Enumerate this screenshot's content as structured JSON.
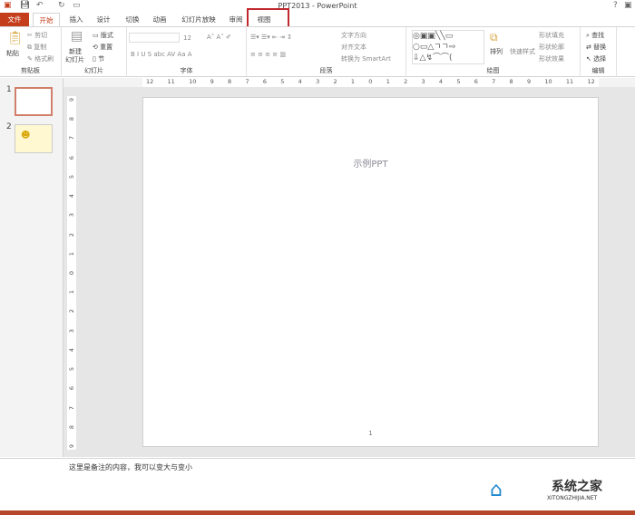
{
  "title": "PPT2013 - PowerPoint",
  "help": "?",
  "tabs": [
    "文件",
    "开始",
    "插入",
    "设计",
    "切换",
    "动画",
    "幻灯片放映",
    "审阅",
    "视图"
  ],
  "ribbon": {
    "clipboard": {
      "label": "剪贴板",
      "paste": "粘贴",
      "cut": "剪切",
      "copy": "复制",
      "format": "格式刷"
    },
    "slides": {
      "label": "幻灯片",
      "new1": "新建",
      "new2": "幻灯片",
      "layout": "版式",
      "reset": "重置",
      "section": "节"
    },
    "font": {
      "label": "字体",
      "size": "12"
    },
    "paragraph": {
      "label": "段落",
      "dir": "文字方向",
      "align": "对齐文本",
      "smart": "转换为 SmartArt"
    },
    "drawing": {
      "label": "绘图",
      "arrange": "排列",
      "quick": "快速样式",
      "fill": "形状填充",
      "outline": "形状轮廓",
      "effect": "形状效果"
    },
    "editing": {
      "label": "编辑",
      "find": "查找",
      "replace": "替换",
      "select": "选择"
    }
  },
  "ruler_h": [
    "12",
    "11",
    "10",
    "9",
    "8",
    "7",
    "6",
    "5",
    "4",
    "3",
    "2",
    "1",
    "0",
    "1",
    "2",
    "3",
    "4",
    "5",
    "6",
    "7",
    "8",
    "9",
    "10",
    "11",
    "12"
  ],
  "ruler_v": [
    "9",
    "8",
    "7",
    "6",
    "5",
    "4",
    "3",
    "2",
    "1",
    "0",
    "1",
    "2",
    "3",
    "4",
    "5",
    "6",
    "7",
    "8",
    "9"
  ],
  "thumbs": [
    {
      "num": "1"
    },
    {
      "num": "2"
    }
  ],
  "slide": {
    "title": "示例PPT",
    "page": "1"
  },
  "notes": "这里是备注的内容，我可以变大与变小",
  "watermark": {
    "cn": "系统之家",
    "en": "XITONGZHIJIA.NET"
  },
  "colors": {
    "accent": "#c43e1c",
    "highlight": "#c0282d"
  }
}
